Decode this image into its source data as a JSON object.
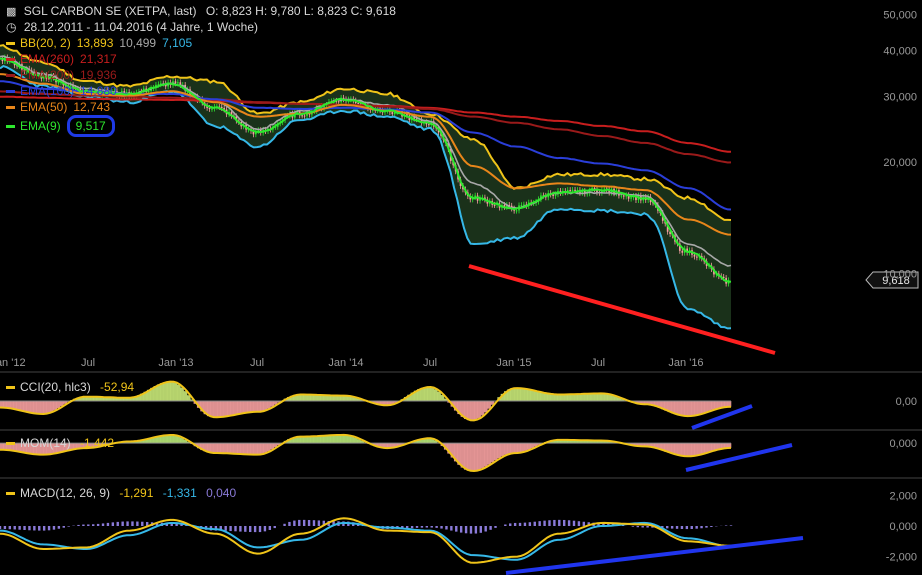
{
  "header": {
    "title": "SGL CARBON SE (XETPA, last)",
    "ohlc": "O: 8,823  H: 9,780  L: 8,823  C: 9,618",
    "range": "28.12.2011 - 11.04.2016 (4 Jahre, 1 Woche)",
    "clock_icon": "clock-icon",
    "chart_icon": "bar-chart-icon"
  },
  "legend": [
    {
      "label": "BB(20, 2)",
      "values": [
        "13,893",
        "10,499",
        "7,105"
      ],
      "colors": [
        "#f0c419",
        "#a8a8a8",
        "#36b8e8"
      ]
    },
    {
      "label": "EMA(260)",
      "values": [
        "21,317"
      ],
      "colors": [
        "#c81e1e"
      ]
    },
    {
      "label": "EMA(200)",
      "values": [
        "19,936"
      ],
      "colors": [
        "#9a1a1a"
      ]
    },
    {
      "label": "EMA(100)",
      "values": [
        "14,880"
      ],
      "colors": [
        "#2a3ed8"
      ]
    },
    {
      "label": "EMA(50)",
      "values": [
        "12,743"
      ],
      "colors": [
        "#e8861a"
      ]
    },
    {
      "label": "EMA(9)",
      "values": [
        "9,517"
      ],
      "colors": [
        "#2ee82e"
      ]
    }
  ],
  "panels": {
    "cci": {
      "label": "CCI(20, hlc3)",
      "values": [
        "-52,94"
      ],
      "colors": [
        "#f0c419"
      ]
    },
    "mom": {
      "label": "MOM(14)",
      "values": [
        "-1,442"
      ],
      "colors": [
        "#f0c419"
      ]
    },
    "macd": {
      "label": "MACD(12, 26, 9)",
      "values": [
        "-1,291",
        "-1,331",
        "0,040"
      ],
      "colors": [
        "#f0c419",
        "#36b8e8",
        "#8a7ad8"
      ]
    }
  },
  "colors": {
    "background": "#000000",
    "bullish": "#2ee82e",
    "bearish": "#f5a0a0",
    "trendline_red": "#ff2020",
    "trendline_blue": "#2035ee",
    "band_fill": "#1e3a1e"
  },
  "chart_data": [
    {
      "type": "line",
      "title": "SGL CARBON SE (XETPA, last)",
      "xlabel": "",
      "ylabel": "",
      "y_scale": "log",
      "ylim": [
        6000,
        52000
      ],
      "grid": false,
      "legend": "top-left",
      "x_tick_labels": [
        "Jan '12",
        "Jul",
        "Jan '13",
        "Jul",
        "Jan '14",
        "Jul",
        "Jan '15",
        "Jul",
        "Jan '16"
      ],
      "y_tick_labels": [
        "50,000",
        "40,000",
        "30,000",
        "20,000",
        "10,000"
      ],
      "y_ticks": [
        50000,
        40000,
        30000,
        20000,
        10000
      ],
      "last_value_label": "9,618",
      "last_value": 9618,
      "x": [
        "2012-01",
        "2012-04",
        "2012-07",
        "2012-10",
        "2013-01",
        "2013-04",
        "2013-07",
        "2013-10",
        "2014-01",
        "2014-04",
        "2014-07",
        "2014-10",
        "2015-01",
        "2015-04",
        "2015-07",
        "2015-10",
        "2016-01",
        "2016-04"
      ],
      "series": [
        {
          "name": "EMA(9)",
          "values": [
            38000,
            34000,
            31000,
            30500,
            32500,
            28000,
            24000,
            27000,
            29500,
            27500,
            25500,
            16000,
            15000,
            16500,
            16800,
            16000,
            11500,
            9517
          ]
        },
        {
          "name": "EMA(50)",
          "values": [
            34500,
            32500,
            30500,
            30200,
            31000,
            29000,
            26500,
            27000,
            28500,
            27500,
            26500,
            19500,
            17000,
            17500,
            17200,
            16800,
            14000,
            12743
          ]
        },
        {
          "name": "EMA(100)",
          "values": [
            33000,
            31500,
            31000,
            30500,
            30500,
            29500,
            28000,
            27800,
            28000,
            27700,
            27200,
            24000,
            22000,
            20500,
            19800,
            19000,
            17000,
            14880
          ]
        },
        {
          "name": "EMA(200)",
          "values": [
            31000,
            30500,
            30200,
            30000,
            29800,
            29500,
            29000,
            28700,
            28500,
            28200,
            27800,
            26500,
            25500,
            24500,
            23500,
            22500,
            21000,
            19936
          ]
        },
        {
          "name": "EMA(260)",
          "values": [
            30000,
            29800,
            29600,
            29500,
            29400,
            29200,
            28900,
            28700,
            28500,
            28300,
            28000,
            27200,
            26500,
            25800,
            25000,
            24200,
            22500,
            21317
          ]
        },
        {
          "name": "BB(20, 2)",
          "values": [
            41000,
            37000,
            33000,
            32000,
            34000,
            33000,
            27000,
            29000,
            31500,
            30500,
            27000,
            23000,
            17000,
            18500,
            18500,
            18000,
            16000,
            13893
          ]
        },
        {
          "name": "BB(20, 2) mid",
          "values": [
            38500,
            34500,
            31500,
            30500,
            32500,
            29000,
            24500,
            27500,
            29500,
            28500,
            25800,
            17500,
            15000,
            16500,
            16500,
            16200,
            12000,
            10499
          ]
        },
        {
          "name": "BB(20, 2) lower",
          "values": [
            36000,
            32000,
            30000,
            29000,
            31000,
            25000,
            22000,
            26000,
            27500,
            26500,
            24500,
            12000,
            12500,
            15000,
            14800,
            14500,
            8000,
            7105
          ]
        }
      ]
    },
    {
      "type": "line",
      "title": "CCI(20, hlc3)",
      "ylim": [
        -250,
        250
      ],
      "y_tick_labels": [
        "0,00"
      ],
      "x": [
        "2012-01",
        "2012-04",
        "2012-07",
        "2012-10",
        "2013-01",
        "2013-04",
        "2013-07",
        "2013-10",
        "2014-01",
        "2014-04",
        "2014-07",
        "2014-10",
        "2015-01",
        "2015-04",
        "2015-07",
        "2015-10",
        "2016-01",
        "2016-04"
      ],
      "series": [
        {
          "name": "CCI(20, hlc3)",
          "values": [
            -60,
            -120,
            40,
            30,
            180,
            -150,
            -100,
            60,
            50,
            -40,
            130,
            -180,
            120,
            60,
            70,
            -30,
            -140,
            -53
          ]
        }
      ]
    },
    {
      "type": "area",
      "title": "MOM(14)",
      "ylim": [
        -10000,
        4000
      ],
      "y_tick_labels": [
        "0,000"
      ],
      "x": [
        "2012-01",
        "2012-04",
        "2012-07",
        "2012-10",
        "2013-01",
        "2013-04",
        "2013-07",
        "2013-10",
        "2014-01",
        "2014-04",
        "2014-07",
        "2014-10",
        "2015-01",
        "2015-04",
        "2015-07",
        "2015-10",
        "2016-01",
        "2016-04"
      ],
      "series": [
        {
          "name": "MOM(14)",
          "values": [
            -2000,
            -3500,
            -1500,
            500,
            2500,
            -3000,
            -3500,
            2000,
            2500,
            -1500,
            1500,
            -8500,
            -3000,
            1000,
            800,
            -1000,
            -4000,
            -1442
          ]
        }
      ]
    },
    {
      "type": "line",
      "title": "MACD(12, 26, 9)",
      "ylim": [
        -3000,
        3000
      ],
      "y_tick_labels": [
        "2,000",
        "0,000",
        "-2,000"
      ],
      "y_ticks": [
        2000,
        0,
        -2000
      ],
      "x": [
        "2012-01",
        "2012-04",
        "2012-07",
        "2012-10",
        "2013-01",
        "2013-04",
        "2013-07",
        "2013-10",
        "2014-01",
        "2014-04",
        "2014-07",
        "2014-10",
        "2015-01",
        "2015-04",
        "2015-07",
        "2015-10",
        "2016-01",
        "2016-04"
      ],
      "series": [
        {
          "name": "MACD",
          "values": [
            -500,
            -1500,
            -1400,
            -300,
            400,
            -500,
            -1800,
            -500,
            500,
            -300,
            -400,
            -2400,
            -2000,
            -500,
            200,
            100,
            -1000,
            -1291
          ]
        },
        {
          "name": "Signal",
          "values": [
            -300,
            -1200,
            -1500,
            -600,
            200,
            -200,
            -1400,
            -900,
            200,
            -100,
            -300,
            -1900,
            -2200,
            -900,
            0,
            200,
            -800,
            -1331
          ]
        },
        {
          "name": "Histogram",
          "values": [
            -200,
            -300,
            100,
            300,
            200,
            -300,
            -400,
            400,
            300,
            -200,
            -100,
            -500,
            200,
            400,
            200,
            -100,
            -200,
            40
          ]
        }
      ]
    }
  ]
}
